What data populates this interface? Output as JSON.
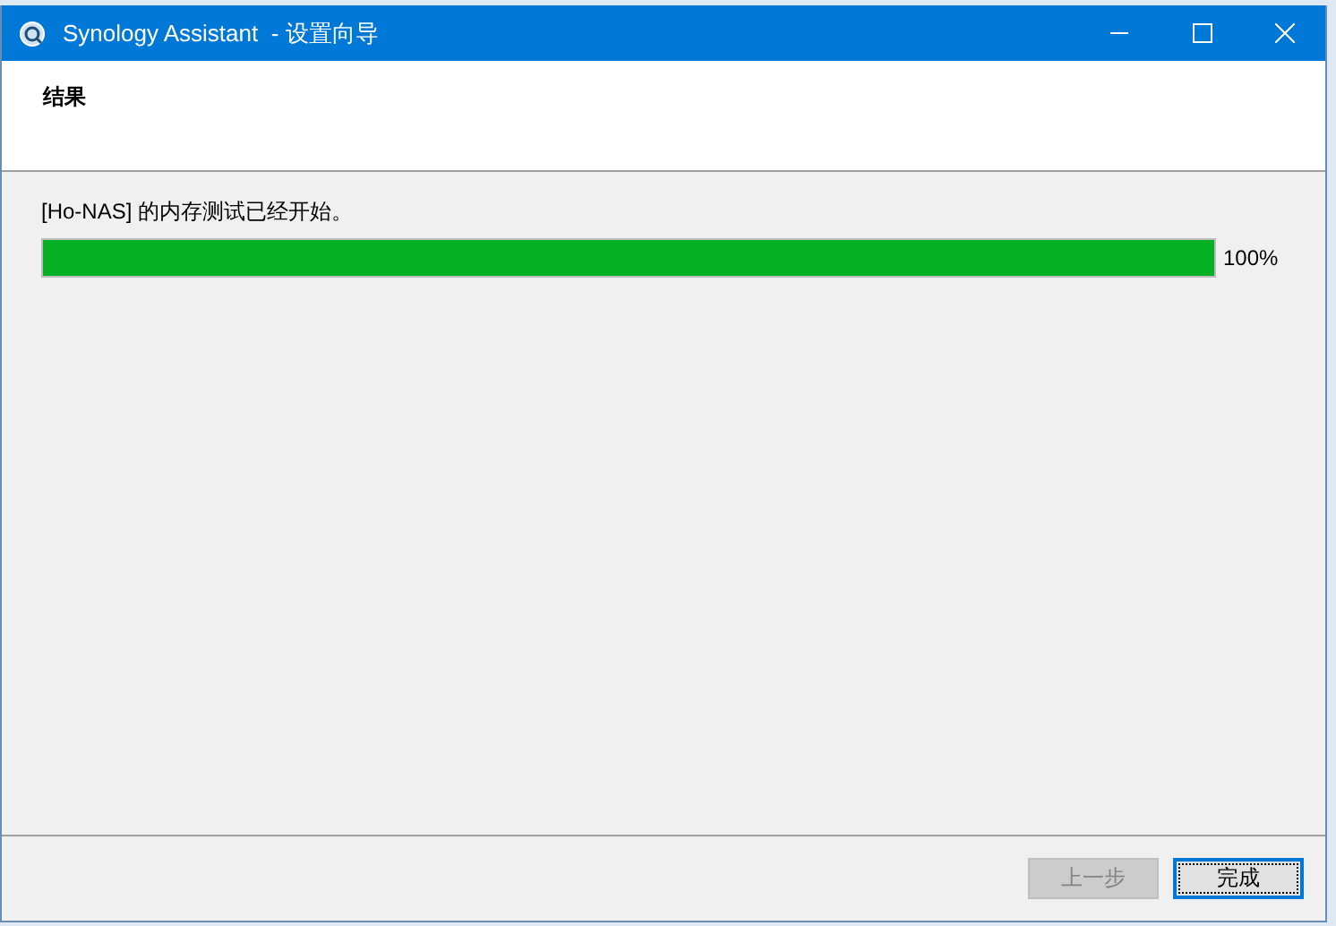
{
  "window": {
    "title": "Synology Assistant  - 设置向导"
  },
  "header": {
    "title": "结果"
  },
  "content": {
    "message": "[Ho-NAS] 的内存测试已经开始。",
    "progress": {
      "level": 1,
      "reading": "100%"
    }
  },
  "buttons": [
    {
      "label": "上一步",
      "disabled": true,
      "focused": false
    },
    {
      "label": "完成",
      "disabled": false,
      "focused": true
    }
  ]
}
